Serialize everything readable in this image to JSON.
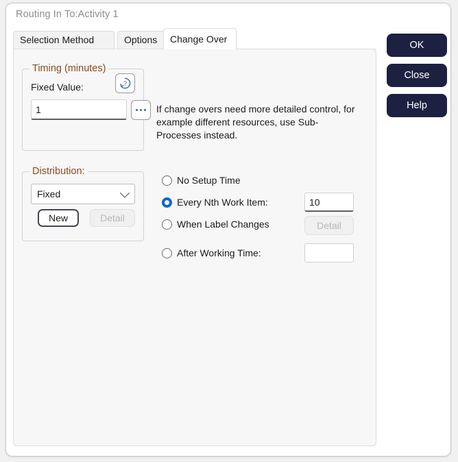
{
  "window": {
    "title": "Routing In To:Activity 1"
  },
  "tabs": [
    {
      "label": "Selection Method",
      "active": false
    },
    {
      "label": "Options",
      "active": false
    },
    {
      "label": "Change Over",
      "active": true
    }
  ],
  "timing_group": {
    "title": "Timing (minutes)",
    "fixed_value_label": "Fixed Value:",
    "fixed_value": "1",
    "fixed_value_placeholder": "",
    "help_icon": "help-circle-icon",
    "browse_icon": "ellipsis-icon"
  },
  "distribution_group": {
    "title": "Distribution:",
    "selected": "Fixed",
    "options": [
      "Fixed"
    ],
    "new_button": "New",
    "detail_button": "Detail",
    "detail_disabled": true
  },
  "info": {
    "text": "If change overs need more detailed control, for example different resources, use Sub-Processes instead."
  },
  "setup_options": {
    "no_setup_time": {
      "label": "No Setup Time",
      "checked": false
    },
    "every_nth": {
      "label": "Every Nth Work Item:",
      "checked": true,
      "value": "10"
    },
    "label_changes": {
      "label": "When Label Changes",
      "checked": false,
      "detail_button": "Detail",
      "detail_disabled": true
    },
    "after_working_time": {
      "label": "After Working Time:",
      "checked": false,
      "value": ""
    }
  },
  "actions": {
    "ok": "OK",
    "close": "Close",
    "help": "Help"
  },
  "colors": {
    "action_button": "#1d2141",
    "group_title": "#8a4b20",
    "radio_accent": "#0a68d0",
    "panel_bg": "#f7f7f7",
    "title_text": "#8d8d8d"
  }
}
